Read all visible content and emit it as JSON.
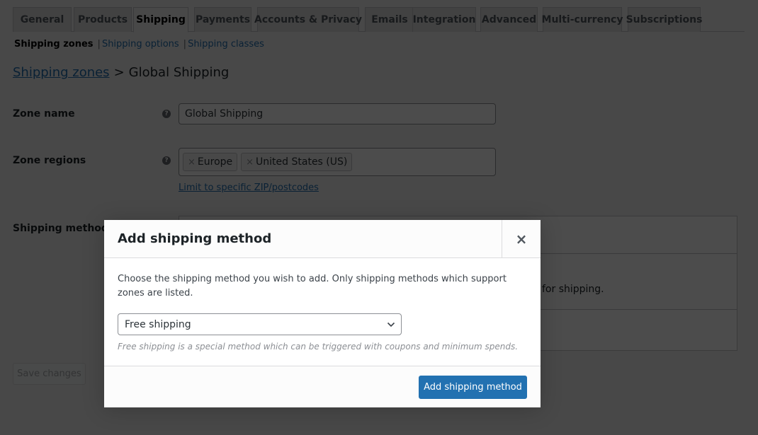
{
  "tabs": [
    {
      "label": "General",
      "active": false
    },
    {
      "label": "Products",
      "active": false
    },
    {
      "label": "Shipping",
      "active": true
    },
    {
      "label": "Payments",
      "active": false
    },
    {
      "label": "Accounts & Privacy",
      "active": false
    },
    {
      "label": "Emails",
      "active": false
    },
    {
      "label": "Integration",
      "active": false
    },
    {
      "label": "Advanced",
      "active": false
    },
    {
      "label": "Multi-currency",
      "active": false
    },
    {
      "label": "Subscriptions",
      "active": false
    }
  ],
  "subnav": {
    "current": "Shipping zones",
    "sep": "|",
    "links": [
      "Shipping options",
      "Shipping classes"
    ]
  },
  "breadcrumb": {
    "parent": "Shipping zones",
    "separator": ">",
    "current": "Global Shipping"
  },
  "form": {
    "zone_name": {
      "label": "Zone name",
      "value": "Global Shipping",
      "help_icon": "?"
    },
    "zone_regions": {
      "label": "Zone regions",
      "help_icon": "?",
      "chips": [
        {
          "remove": "×",
          "label": "Europe"
        },
        {
          "remove": "×",
          "label": "United States (US)"
        }
      ],
      "zip_link": "Limit to specific ZIP/postcodes"
    },
    "shipping_methods": {
      "label": "Shipping methods",
      "visible_note": "for shipping."
    },
    "save_label": "Save changes"
  },
  "modal": {
    "title": "Add shipping method",
    "close_glyph": "×",
    "description": "Choose the shipping method you wish to add. Only shipping methods which support zones are listed.",
    "select_value": "Free shipping",
    "hint": "Free shipping is a special method which can be triggered with coupons and minimum spends.",
    "submit_label": "Add shipping method"
  },
  "colors": {
    "accent": "#2271b1",
    "overlay": "rgba(0,0,0,0.7)"
  }
}
